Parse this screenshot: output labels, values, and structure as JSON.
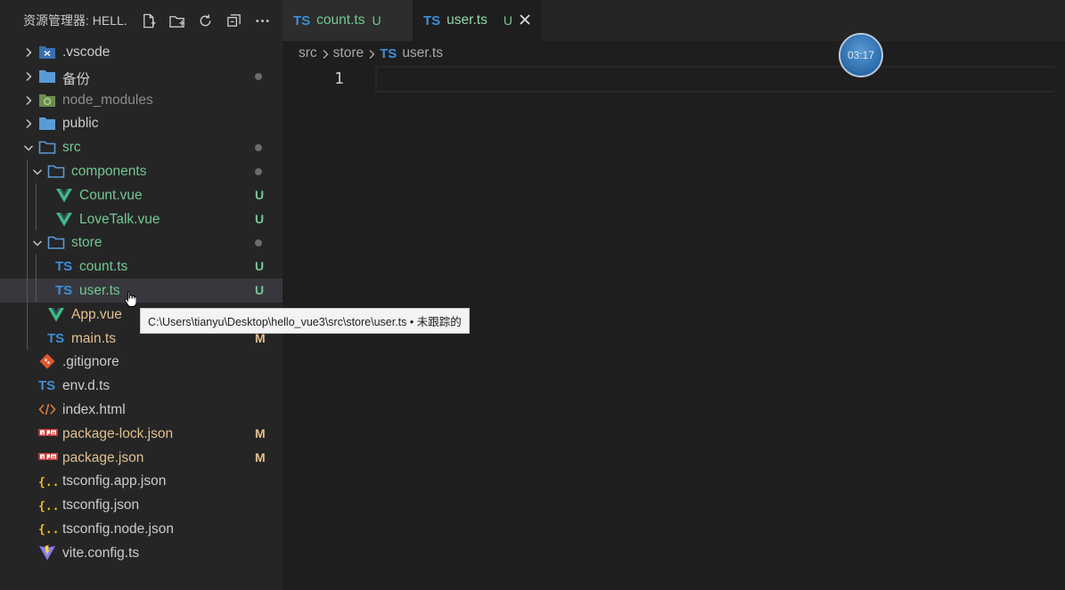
{
  "sidebar": {
    "title": "资源管理器: HELL...",
    "actions": [
      "new-file-icon",
      "new-folder-icon",
      "refresh-icon",
      "collapse-icon",
      "more-icon"
    ]
  },
  "tree": [
    {
      "label": "vscode",
      "prefix": ".",
      "kind": "folder-vscode",
      "depth": 0,
      "chevron": "right",
      "label_color": "#cccccc",
      "status": ""
    },
    {
      "label": "备份",
      "kind": "folder",
      "depth": 0,
      "chevron": "right",
      "label_color": "#cccccc",
      "status": "dot"
    },
    {
      "label": "node_modules",
      "kind": "folder-node",
      "depth": 0,
      "chevron": "right",
      "label_color": "#8c8c8c",
      "status": ""
    },
    {
      "label": "public",
      "kind": "folder",
      "depth": 0,
      "chevron": "right",
      "label_color": "#cccccc",
      "status": ""
    },
    {
      "label": "src",
      "kind": "folder-open",
      "depth": 0,
      "chevron": "down",
      "label_color": "#73c991",
      "status": "dot"
    },
    {
      "label": "components",
      "kind": "folder-open",
      "depth": 1,
      "chevron": "down",
      "label_color": "#73c991",
      "status": "dot"
    },
    {
      "label": "Count.vue",
      "kind": "vue",
      "depth": 2,
      "chevron": "",
      "label_color": "#73c991",
      "status": "U"
    },
    {
      "label": "LoveTalk.vue",
      "kind": "vue",
      "depth": 2,
      "chevron": "",
      "label_color": "#73c991",
      "status": "U"
    },
    {
      "label": "store",
      "kind": "folder-open",
      "depth": 1,
      "chevron": "down",
      "label_color": "#73c991",
      "status": "dot"
    },
    {
      "label": "count.ts",
      "kind": "ts",
      "depth": 2,
      "chevron": "",
      "label_color": "#73c991",
      "status": "U"
    },
    {
      "label": "user.ts",
      "kind": "ts",
      "depth": 2,
      "chevron": "",
      "label_color": "#73c991",
      "status": "U",
      "selected": true
    },
    {
      "label": "App.vue",
      "kind": "vue",
      "depth": 1,
      "chevron": "",
      "label_color": "#e2c08d",
      "status": ""
    },
    {
      "label": "main.ts",
      "kind": "ts",
      "depth": 1,
      "chevron": "",
      "label_color": "#e2c08d",
      "status": "M"
    },
    {
      "label": "gitignore",
      "prefix": ".",
      "kind": "git",
      "depth": 0,
      "chevron": "",
      "label_color": "#cccccc",
      "status": ""
    },
    {
      "label": "env.d.ts",
      "kind": "ts",
      "depth": 0,
      "chevron": "",
      "label_color": "#cccccc",
      "status": ""
    },
    {
      "label": "index.html",
      "kind": "html",
      "depth": 0,
      "chevron": "",
      "label_color": "#cccccc",
      "status": ""
    },
    {
      "label": "package-lock.json",
      "kind": "npm",
      "depth": 0,
      "chevron": "",
      "label_color": "#e2c08d",
      "status": "M"
    },
    {
      "label": "package.json",
      "kind": "npm",
      "depth": 0,
      "chevron": "",
      "label_color": "#e2c08d",
      "status": "M"
    },
    {
      "label": "tsconfig.app.json",
      "kind": "json",
      "depth": 0,
      "chevron": "",
      "label_color": "#cccccc",
      "status": ""
    },
    {
      "label": "tsconfig.json",
      "kind": "json",
      "depth": 0,
      "chevron": "",
      "label_color": "#cccccc",
      "status": ""
    },
    {
      "label": "tsconfig.node.json",
      "kind": "json",
      "depth": 0,
      "chevron": "",
      "label_color": "#cccccc",
      "status": ""
    },
    {
      "label": "vite.config.ts",
      "kind": "vite",
      "depth": 0,
      "chevron": "",
      "label_color": "#cccccc",
      "status": ""
    }
  ],
  "tabs": [
    {
      "icon_text": "TS",
      "label": "count.ts",
      "badge": "U",
      "active": false
    },
    {
      "icon_text": "TS",
      "label": "user.ts",
      "badge": "U",
      "active": true
    }
  ],
  "breadcrumb": {
    "parts": [
      "src",
      "store"
    ],
    "file_icon_text": "TS",
    "file": "user.ts"
  },
  "editor": {
    "line_number": "1"
  },
  "timer": {
    "text": "03:17"
  },
  "tooltip": {
    "text": "C:\\Users\\tianyu\\Desktop\\hello_vue3\\src\\store\\user.ts • 未跟踪的"
  },
  "colors": {
    "ts_blue": "#3d8fd6",
    "vue_green": "#41b883",
    "folder_blue": "#5a9ad6",
    "untracked_green": "#73c991",
    "modified_yellow": "#e2c08d"
  }
}
